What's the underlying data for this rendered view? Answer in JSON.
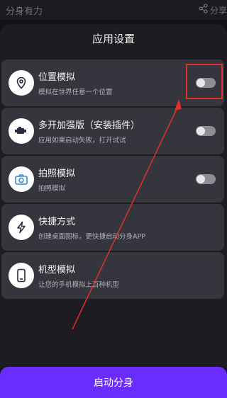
{
  "app": {
    "title": "分身有力",
    "share_label": "分享"
  },
  "dialog": {
    "title": "应用设置"
  },
  "settings": [
    {
      "label": "位置模拟",
      "desc": "模拟在世界任意一个位置",
      "icon": "location-pin-icon",
      "has_toggle": true,
      "toggle_on": false
    },
    {
      "label": "多开加强版（安装插件）",
      "desc": "应用如果启动失败，打开试试",
      "icon": "engine-icon",
      "has_toggle": true,
      "toggle_on": false
    },
    {
      "label": "拍照模拟",
      "desc": "拍照模拟",
      "icon": "camera-icon",
      "has_toggle": true,
      "toggle_on": false
    },
    {
      "label": "快捷方式",
      "desc": "创建桌面图标，更快捷启动分身APP",
      "icon": "lightning-icon",
      "has_toggle": false
    },
    {
      "label": "机型模拟",
      "desc": "让您的手机模拟上百种机型",
      "icon": "phone-icon",
      "has_toggle": false
    }
  ],
  "primary_action": {
    "label": "启动分身"
  },
  "colors": {
    "accent": "#6b2cff",
    "card": "#35353d",
    "annotation": "#e0302a"
  }
}
